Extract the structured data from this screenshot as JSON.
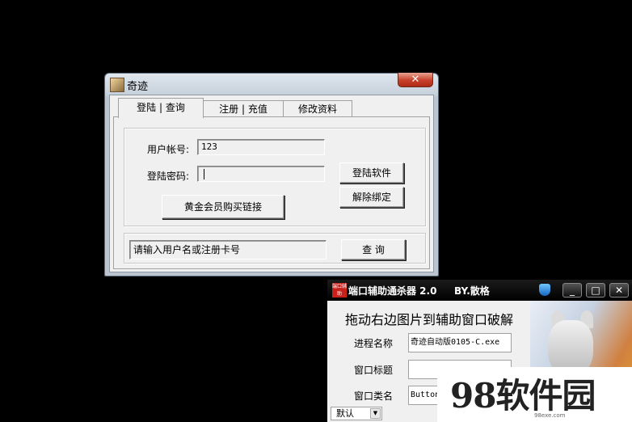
{
  "main_window": {
    "title": "奇迹",
    "close_glyph": "✕",
    "tabs": [
      {
        "label": "登陆 | 查询",
        "active": true
      },
      {
        "label": "注册 | 充值",
        "active": false
      },
      {
        "label": "修改资料",
        "active": false
      }
    ],
    "username_label": "用户帐号:",
    "username_value": "123",
    "password_label": "登陆密码:",
    "password_value": "",
    "login_button": "登陆软件",
    "unbind_button": "解除绑定",
    "buy_link_button": "黄金会员购买链接",
    "status_text": "请输入用户名或注册卡号",
    "query_button": "查 询"
  },
  "secondary_window": {
    "logo_text": "端口辅助",
    "title": "端口辅助通杀器 2.0",
    "author": "BY.散格",
    "minimize_glyph": "_",
    "maximize_glyph": "□",
    "close_glyph": "✕",
    "headline": "拖动右边图片到辅助窗口破解",
    "process_label": "进程名称",
    "process_value": "奇迹自动版0105-C.exe",
    "window_title_label": "窗口标题",
    "window_title_value": "",
    "window_class_label": "窗口类名",
    "window_class_value": "Button",
    "combo_value": "默认",
    "combo_arrow": "▼"
  },
  "watermark": {
    "text": "98软件园",
    "url": "98exe.com"
  },
  "colors": {
    "desktop": "#000000",
    "client_bg": "#f0f0f0",
    "close_red": "#c7402a"
  }
}
